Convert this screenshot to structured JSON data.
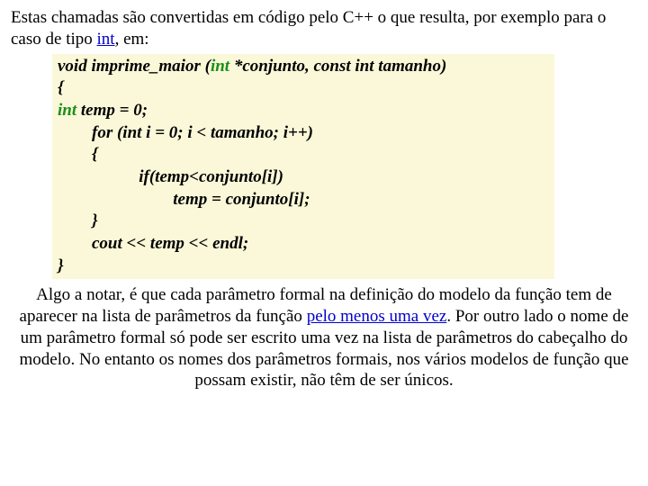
{
  "para1": {
    "t1": "Estas chamadas são convertidas em código pelo C++ o que resulta, por exemplo para o caso de tipo ",
    "type_kw": "int",
    "t2": ", em:"
  },
  "code": {
    "l1a": "void imprime_maior (",
    "l1_type": "int",
    "l1b": " *conjunto, const int tamanho)",
    "l2": "{",
    "l3a": "int",
    "l3b": " temp = 0;",
    "l4": "        for (int i = 0; i < tamanho; i++)",
    "l5": "        {",
    "l6": "                   if(temp<conjunto[i])",
    "l7": "                           temp = conjunto[i];",
    "l8": "        }",
    "l9": "        cout << temp << endl;",
    "l10": "}"
  },
  "para2": {
    "t1": "Algo a notar, é que cada parâmetro formal na definição do modelo da função tem de aparecer na lista de parâmetros da função ",
    "link": "pelo menos uma vez",
    "t2": ". Por outro lado o nome de um parâmetro formal só pode ser escrito uma vez na lista de parâmetros do cabeçalho do modelo. No entanto os nomes dos parâmetros formais, nos vários modelos de função que possam existir, não têm de ser únicos."
  }
}
